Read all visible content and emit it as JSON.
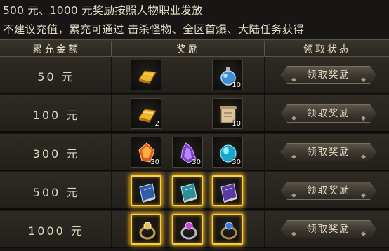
{
  "notice": {
    "line1": "500 元、1000 元奖励按照人物职业发放",
    "line2": "不建议充值，累充可通过 击杀怪物、全区首爆、大陆任务获得"
  },
  "table": {
    "headers": [
      "累充金额",
      "奖励",
      "领取状态"
    ],
    "rows": [
      {
        "amount": "50 元",
        "claim_label": "领取奖励",
        "rewards": [
          {
            "icon": "gold-bar-icon",
            "count": ""
          },
          {
            "icon": "blue-potion-icon",
            "count": "10"
          }
        ]
      },
      {
        "amount": "100 元",
        "claim_label": "领取奖励",
        "rewards": [
          {
            "icon": "gold-bar-icon",
            "count": "2"
          },
          {
            "icon": "scroll-icon",
            "count": "10"
          }
        ]
      },
      {
        "amount": "300 元",
        "claim_label": "领取奖励",
        "rewards": [
          {
            "icon": "fire-crystal-icon",
            "count": "30"
          },
          {
            "icon": "purple-crystal-icon",
            "count": "30"
          },
          {
            "icon": "cyan-gem-icon",
            "count": "30"
          }
        ]
      },
      {
        "amount": "500 元",
        "claim_label": "领取奖励",
        "rewards": [
          {
            "icon": "blue-skill-book-icon",
            "count": "",
            "highlight": true
          },
          {
            "icon": "cyan-skill-book-icon",
            "count": "",
            "highlight": true
          },
          {
            "icon": "purple-skill-book-icon",
            "count": "",
            "highlight": true
          }
        ]
      },
      {
        "amount": "1000 元",
        "claim_label": "领取奖励",
        "rewards": [
          {
            "icon": "gold-ring-icon",
            "count": "",
            "highlight": true
          },
          {
            "icon": "silver-ring-icon",
            "count": "",
            "highlight": true
          },
          {
            "icon": "blue-ring-icon",
            "count": "",
            "highlight": true
          }
        ]
      }
    ]
  },
  "colors": {
    "highlight_border": "#ffcf3a",
    "header_text": "#e8dfc6",
    "row_bg": "#2e2a24"
  }
}
